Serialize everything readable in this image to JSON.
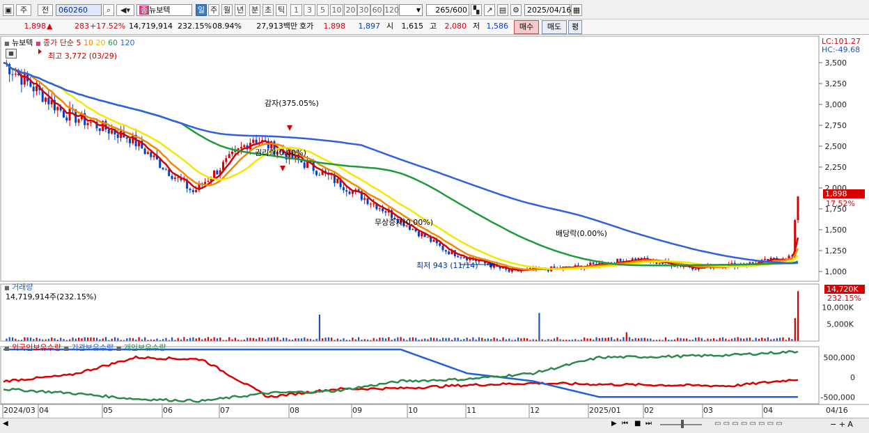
{
  "toolbar": {
    "market_label": "주",
    "prev_label": "전",
    "code": "060260",
    "stock_name": "뉴보텍",
    "periods": [
      "일",
      "주",
      "월",
      "년",
      "분",
      "초",
      "틱"
    ],
    "active_period": "일",
    "minute_options": [
      "1",
      "3",
      "5",
      "10",
      "20",
      "30",
      "60",
      "120"
    ],
    "count": "265",
    "count_max": "/600",
    "date": "2025/04/16"
  },
  "quote": {
    "price": "1,898",
    "change": "283",
    "change_pct": "+17.52%",
    "volume": "14,719,914",
    "volume_ratio": "232.15%",
    "turnover": "08.94%",
    "amount": "27,913백만",
    "hoga_label": "호가",
    "ask": "1,898",
    "bid": "1,897",
    "open_label": "시",
    "open": "1,615",
    "high_label": "고",
    "high": "2,080",
    "low_label": "저",
    "low": "1,586",
    "buy_label": "매수",
    "sell_label": "매도",
    "eval_label": "평"
  },
  "price_panel": {
    "name": "뉴보텍",
    "indicator": "종가 단순",
    "ma_periods": [
      "5",
      "10",
      "20",
      "60",
      "120"
    ],
    "ma_colors": {
      "5": "#d80000",
      "10": "#f08a00",
      "20": "#f6e600",
      "60": "#1f9a3c",
      "120": "#3060e0"
    },
    "lc": "LC:101.27",
    "hc": "HC:-49.68",
    "current_tag": "1,898",
    "current_pct": "17.52%",
    "y_ticks": [
      "3,500",
      "3,250",
      "3,000",
      "2,750",
      "2,500",
      "2,250",
      "2,000",
      "1,750",
      "1,500",
      "1,250",
      "1,000"
    ],
    "annotations": {
      "high": "최고 3,772 (03/29)",
      "low": "최저 943 (11/14)",
      "capital_reduction": "감자(375.05%)",
      "ex_rights": "권리락(0.00%)",
      "bonus_issue": "무상증자(0.00%)",
      "ex_dividend": "배당락(0.00%)"
    }
  },
  "volume_panel": {
    "title": "거래량",
    "value_label": "14,719,914주(232.15%)",
    "current_tag": "14,720K",
    "current_pct": "232.15%",
    "y_ticks": [
      "10,000K",
      "5,000K"
    ]
  },
  "holding_panel": {
    "series_names": [
      "외국인보유수량",
      "기관보유수량",
      "개인보유수량"
    ],
    "series_colors": [
      "#d80000",
      "#2060d8",
      "#2a8a4a"
    ],
    "y_ticks": [
      "500,000",
      "0",
      "-500,000"
    ]
  },
  "x_axis": {
    "labels": [
      "2024/03",
      "04",
      "05",
      "06",
      "07",
      "08",
      "09",
      "10",
      "11",
      "12",
      "2025/01",
      "02",
      "03",
      "04"
    ],
    "right_label": "04/16"
  },
  "chart_data": {
    "type": "line",
    "price_series": {
      "name": "뉴보텍",
      "x": [
        "2024/03",
        "2024/04",
        "2024/05",
        "2024/06",
        "2024/07",
        "2024/08",
        "2024/09",
        "2024/10",
        "2024/11",
        "2024/12",
        "2025/01",
        "2025/02",
        "2025/03",
        "2025/04",
        "2025/04/16"
      ],
      "values": [
        3500,
        2900,
        2600,
        1950,
        2600,
        2200,
        1750,
        1250,
        1000,
        1050,
        1150,
        1050,
        1100,
        1180,
        1898
      ]
    },
    "volume_series": {
      "name": "거래량",
      "unit": "K",
      "current": 14720
    },
    "holding_series": [
      {
        "name": "외국인보유수량",
        "values": [
          -100000,
          50000,
          500000,
          450000,
          -500000,
          -300000,
          -280000,
          -200000,
          -150000,
          -180000,
          -200000,
          -220000,
          -50000
        ]
      },
      {
        "name": "기관보유수량",
        "values": [
          700000,
          700000,
          700000,
          700000,
          700000,
          700000,
          700000,
          100000,
          -100000,
          -500000,
          -500000,
          -500000,
          -500000
        ]
      },
      {
        "name": "개인보유수량",
        "values": [
          -300000,
          -400000,
          -550000,
          -600000,
          -400000,
          -350000,
          -100000,
          -50000,
          100000,
          500000,
          520000,
          560000,
          650000
        ]
      }
    ],
    "ylim_price": [
      900,
      3800
    ],
    "ylim_holding": [
      -600000,
      700000
    ]
  }
}
